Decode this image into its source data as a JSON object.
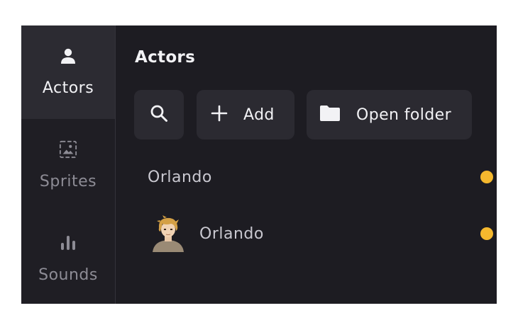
{
  "sidebar": {
    "items": [
      {
        "label": "Actors",
        "icon": "person-icon",
        "active": true
      },
      {
        "label": "Sprites",
        "icon": "image-icon",
        "active": false
      },
      {
        "label": "Sounds",
        "icon": "bars-icon",
        "active": false
      }
    ]
  },
  "main": {
    "title": "Actors",
    "toolbar": {
      "search_icon": "search-icon",
      "add_label": "Add",
      "open_folder_label": "Open folder"
    },
    "actors": [
      {
        "name": "Orlando",
        "status_color": "#f5b82e",
        "has_avatar": false
      },
      {
        "name": "Orlando",
        "status_color": "#f5b82e",
        "has_avatar": true
      }
    ]
  },
  "colors": {
    "background": "#1d1c22",
    "sidebar_active": "#2c2b32",
    "button_bg": "#2b2a31",
    "status_dot": "#f5b82e"
  }
}
